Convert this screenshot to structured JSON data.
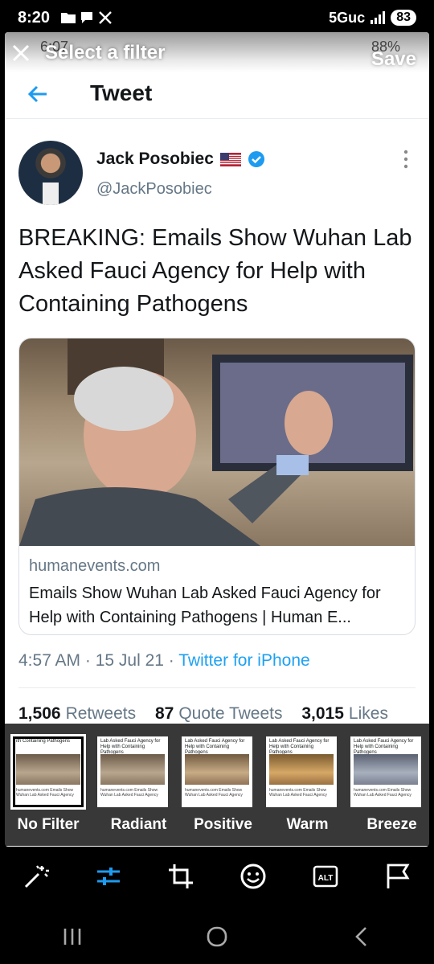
{
  "status_bar": {
    "time": "8:20",
    "network": "5Guc",
    "battery": "83",
    "icons": [
      "folder-icon",
      "chat-icon",
      "x-app-icon",
      "signal-icon"
    ]
  },
  "overlay": {
    "title": "Select a filter",
    "save_label": "Save",
    "close_icon": "close-icon"
  },
  "screenshot": {
    "status_time": "6:07",
    "status_battery": "88%",
    "header_title": "Tweet",
    "author": {
      "name": "Jack Posobiec",
      "handle": "@JackPosobiec"
    },
    "tweet_text": "BREAKING: Emails Show Wuhan Lab Asked Fauci Agency for Help with Containing Pathogens",
    "card": {
      "domain": "humanevents.com",
      "title": "Emails Show Wuhan Lab Asked Fauci Agency for Help with Containing Pathogens | Human E..."
    },
    "meta": {
      "time": "4:57 AM",
      "date": "15 Jul 21",
      "source": "Twitter for iPhone"
    },
    "stats": [
      {
        "count": "1,506",
        "label": "Retweets"
      },
      {
        "count": "87",
        "label": "Quote Tweets"
      },
      {
        "count": "3,015",
        "label": "Likes"
      }
    ]
  },
  "filters": [
    {
      "label": "No Filter",
      "selected": true
    },
    {
      "label": "Radiant",
      "selected": false
    },
    {
      "label": "Positive",
      "selected": false
    },
    {
      "label": "Warm",
      "selected": false
    },
    {
      "label": "Breeze",
      "selected": false
    }
  ],
  "toolbar": [
    {
      "icon": "magic-wand-icon"
    },
    {
      "icon": "adjust-sliders-icon",
      "active": true
    },
    {
      "icon": "crop-icon"
    },
    {
      "icon": "sticker-smiley-icon"
    },
    {
      "icon": "alt-text-icon",
      "label": "ALT"
    },
    {
      "icon": "flag-icon"
    }
  ],
  "colors": {
    "accent": "#1d9bf0",
    "twitter_blue": "#1da1f2",
    "text": "#14171a",
    "muted": "#657786"
  }
}
